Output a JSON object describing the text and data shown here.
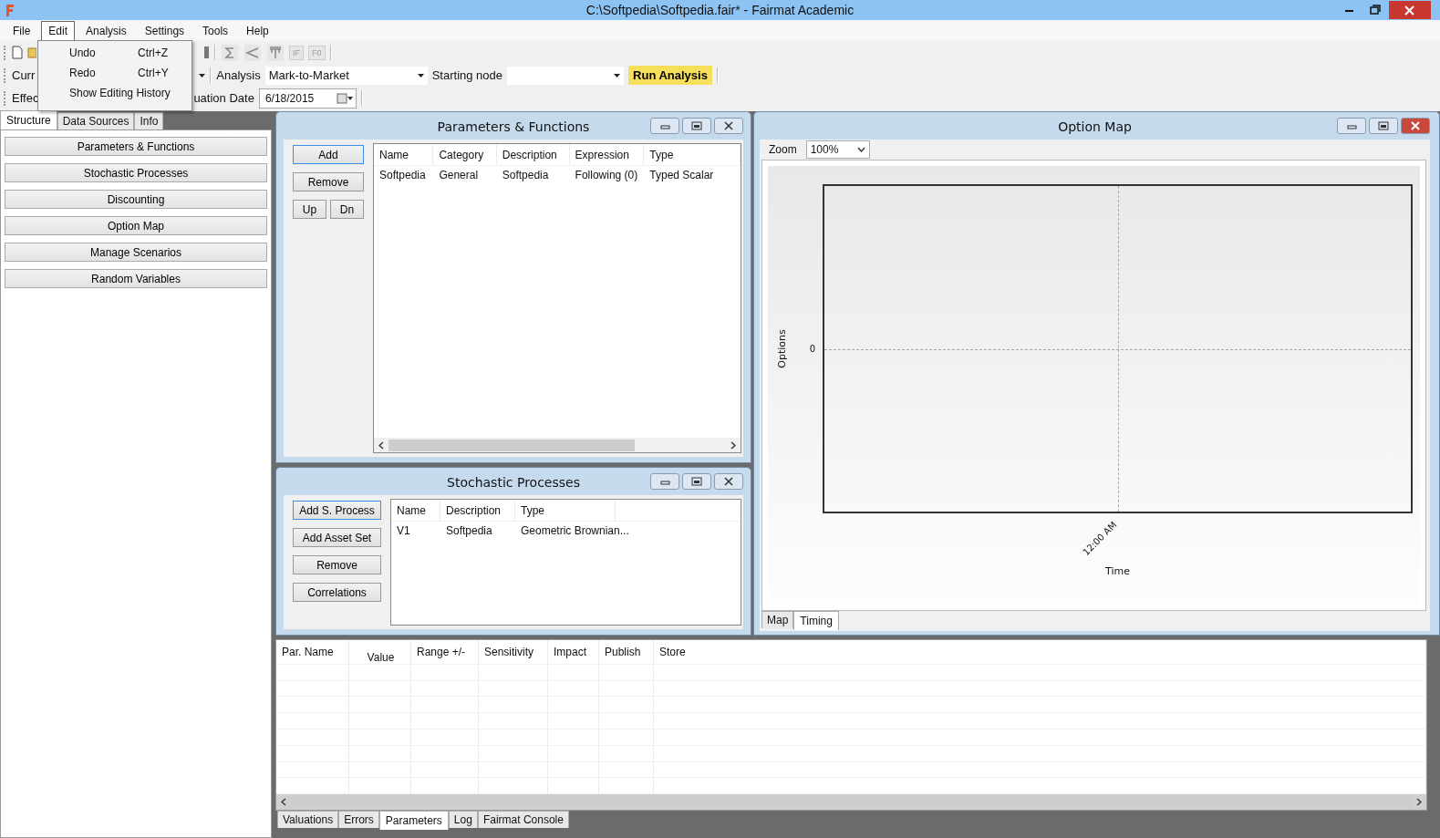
{
  "window": {
    "title": "C:\\Softpedia\\Softpedia.fair* - Fairmat Academic"
  },
  "menu": [
    {
      "label": "File",
      "selected": false
    },
    {
      "label": "Edit",
      "selected": true
    },
    {
      "label": "Analysis",
      "selected": false
    },
    {
      "label": "Settings",
      "selected": false
    },
    {
      "label": "Tools",
      "selected": false
    },
    {
      "label": "Help",
      "selected": false
    }
  ],
  "edit_menu": [
    {
      "label": "Undo",
      "shortcut": "Ctrl+Z"
    },
    {
      "label": "Redo",
      "shortcut": "Ctrl+Y"
    },
    {
      "label": "Show Editing History"
    }
  ],
  "toolbar": {
    "formula_buttons": [
      "IF",
      "F0"
    ]
  },
  "toolbar_row_2": {
    "currency_label": "Curr",
    "analysis_label": "Analysis",
    "analysis_value": "Mark-to-Market",
    "starting_node_label": "Starting node",
    "run_button": "Run Analysis"
  },
  "toolbar_row_3": {
    "effective_label": "Effec",
    "valuation_date_label": "uation Date",
    "valuation_date": "6/18/2015"
  },
  "left_panel": {
    "tabs": [
      {
        "label": "Structure",
        "selected": true
      },
      {
        "label": "Data Sources",
        "selected": false
      },
      {
        "label": "Info",
        "selected": false
      }
    ],
    "buttons": [
      "Parameters & Functions",
      "Stochastic Processes",
      "Discounting",
      "Option Map",
      "Manage Scenarios",
      "Random Variables"
    ]
  },
  "parameters_window": {
    "title": "Parameters & Functions",
    "buttons": [
      "Add",
      "Remove",
      "Up",
      "Dn"
    ],
    "columns": [
      "Name",
      "Category",
      "Description",
      "Expression",
      "Type"
    ],
    "rows": [
      [
        "Softpedia",
        "General",
        "Softpedia",
        "Following (0)",
        "Typed Scalar"
      ]
    ]
  },
  "stochastic_window": {
    "title": "Stochastic Processes",
    "buttons": [
      "Add S. Process",
      "Add Asset Set",
      "Remove",
      "Correlations"
    ],
    "columns": [
      "Name",
      "Description",
      "Type"
    ],
    "rows": [
      [
        "V1",
        "Softpedia",
        "Geometric Brownian..."
      ]
    ]
  },
  "option_map": {
    "title": "Option Map",
    "zoom_label": "Zoom",
    "zoom_value": "100%",
    "y_label": "Options",
    "y_tick": "0",
    "x_tick": "12:00 AM",
    "x_label": "Time",
    "tabs": [
      {
        "label": "Map",
        "selected": false
      },
      {
        "label": "Timing",
        "selected": true
      }
    ]
  },
  "parameters_table": {
    "columns": [
      "Par. Name",
      "Value",
      "Range +/-",
      "Sensitivity",
      "Impact",
      "Publish",
      "Store"
    ]
  },
  "bottom_tabs": [
    {
      "label": "Valuations",
      "selected": false
    },
    {
      "label": "Errors",
      "selected": false
    },
    {
      "label": "Parameters",
      "selected": true
    },
    {
      "label": "Log",
      "selected": false
    },
    {
      "label": "Fairmat Console",
      "selected": false
    }
  ]
}
